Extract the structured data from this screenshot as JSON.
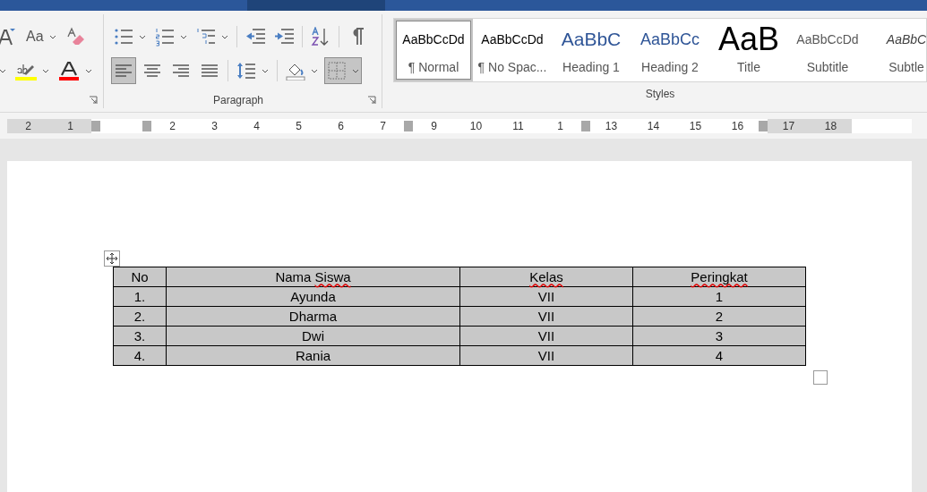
{
  "ribbon": {
    "font_group": {
      "row1": [
        {
          "kind": "grow-font",
          "dropdown": false
        },
        {
          "kind": "change-case",
          "label": "Aa",
          "dropdown": true
        },
        {
          "kind": "clear-formatting",
          "dropdown": false
        }
      ],
      "row2": [
        {
          "kind": "caret-only",
          "dropdown": true
        },
        {
          "kind": "highlight",
          "dropdown": true
        },
        {
          "kind": "font-color",
          "dropdown": true
        }
      ]
    },
    "paragraph": {
      "label": "Paragraph",
      "row1": [
        {
          "kind": "bullets",
          "dropdown": true,
          "selected": false
        },
        {
          "kind": "numbering",
          "dropdown": true,
          "selected": false
        },
        {
          "kind": "multilevel",
          "dropdown": true,
          "selected": false
        },
        {
          "kind": "sep"
        },
        {
          "kind": "outdent",
          "dropdown": false,
          "selected": false
        },
        {
          "kind": "indent",
          "dropdown": false,
          "selected": false
        },
        {
          "kind": "sep"
        },
        {
          "kind": "sort",
          "dropdown": false,
          "selected": false
        },
        {
          "kind": "sep"
        },
        {
          "kind": "pilcrow",
          "dropdown": false,
          "selected": false
        }
      ],
      "row2": [
        {
          "kind": "align-left",
          "dropdown": false,
          "selected": true
        },
        {
          "kind": "align-center",
          "dropdown": false,
          "selected": false
        },
        {
          "kind": "align-right",
          "dropdown": false,
          "selected": false
        },
        {
          "kind": "justify",
          "dropdown": false,
          "selected": false
        },
        {
          "kind": "sep"
        },
        {
          "kind": "line-spacing",
          "dropdown": true,
          "selected": false
        },
        {
          "kind": "sep"
        },
        {
          "kind": "shading",
          "dropdown": true,
          "selected": false
        },
        {
          "kind": "borders",
          "dropdown": true,
          "selected": true
        }
      ]
    },
    "styles": {
      "label": "Styles",
      "items": [
        {
          "kind": "normal",
          "sample": "AaBbCcDd",
          "label": "¶ Normal",
          "selected": true
        },
        {
          "kind": "no-spacing",
          "sample": "AaBbCcDd",
          "label": "¶ No Spac...",
          "selected": false
        },
        {
          "kind": "heading1",
          "sample": "AaBbC",
          "label": "Heading 1",
          "selected": false
        },
        {
          "kind": "heading2",
          "sample": "AaBbCc",
          "label": "Heading 2",
          "selected": false
        },
        {
          "kind": "title",
          "sample": "AaB",
          "label": "Title",
          "selected": false
        },
        {
          "kind": "subtitle",
          "sample": "AaBbCcDd",
          "label": "Subtitle",
          "selected": false
        },
        {
          "kind": "subtle",
          "sample": "AaBbC",
          "label": "Subtle",
          "selected": false
        }
      ]
    }
  },
  "ruler": {
    "slots": [
      {
        "kind": "margin-number",
        "text": "2"
      },
      {
        "kind": "margin-number",
        "text": "1"
      },
      {
        "kind": "marker"
      },
      {
        "kind": "blank"
      },
      {
        "kind": "marker"
      },
      {
        "kind": "number",
        "text": "2"
      },
      {
        "kind": "number",
        "text": "3"
      },
      {
        "kind": "number",
        "text": "4"
      },
      {
        "kind": "number",
        "text": "5"
      },
      {
        "kind": "number",
        "text": "6"
      },
      {
        "kind": "number",
        "text": "7"
      },
      {
        "kind": "marker"
      },
      {
        "kind": "number",
        "text": "9"
      },
      {
        "kind": "number",
        "text": "10"
      },
      {
        "kind": "number",
        "text": "11"
      },
      {
        "kind": "number",
        "text": "1"
      },
      {
        "kind": "marker"
      },
      {
        "kind": "number",
        "text": "13"
      },
      {
        "kind": "number",
        "text": "14"
      },
      {
        "kind": "number",
        "text": "15"
      },
      {
        "kind": "number",
        "text": "16"
      },
      {
        "kind": "marker"
      },
      {
        "kind": "margin-number",
        "text": "17"
      },
      {
        "kind": "margin-number",
        "text": "18"
      }
    ]
  },
  "table": {
    "header": {
      "selected": true,
      "cells": [
        [
          {
            "text": "No",
            "misspelled": false
          }
        ],
        [
          {
            "text": "Nama",
            "misspelled": false
          },
          {
            "text": "Siswa",
            "misspelled": true
          }
        ],
        [
          {
            "text": "Kelas",
            "misspelled": true
          }
        ],
        [
          {
            "text": "Peringkat",
            "misspelled": true
          }
        ]
      ]
    },
    "rows": [
      {
        "selected": true,
        "cells": [
          "1.",
          "Ayunda",
          "VII",
          "1"
        ]
      },
      {
        "selected": true,
        "cells": [
          "2.",
          "Dharma",
          "VII",
          "2"
        ]
      },
      {
        "selected": true,
        "cells": [
          "3.",
          "Dwi",
          "VII",
          "3"
        ]
      },
      {
        "selected": true,
        "cells": [
          "4.",
          "Rania",
          "VII",
          "4"
        ]
      }
    ]
  }
}
